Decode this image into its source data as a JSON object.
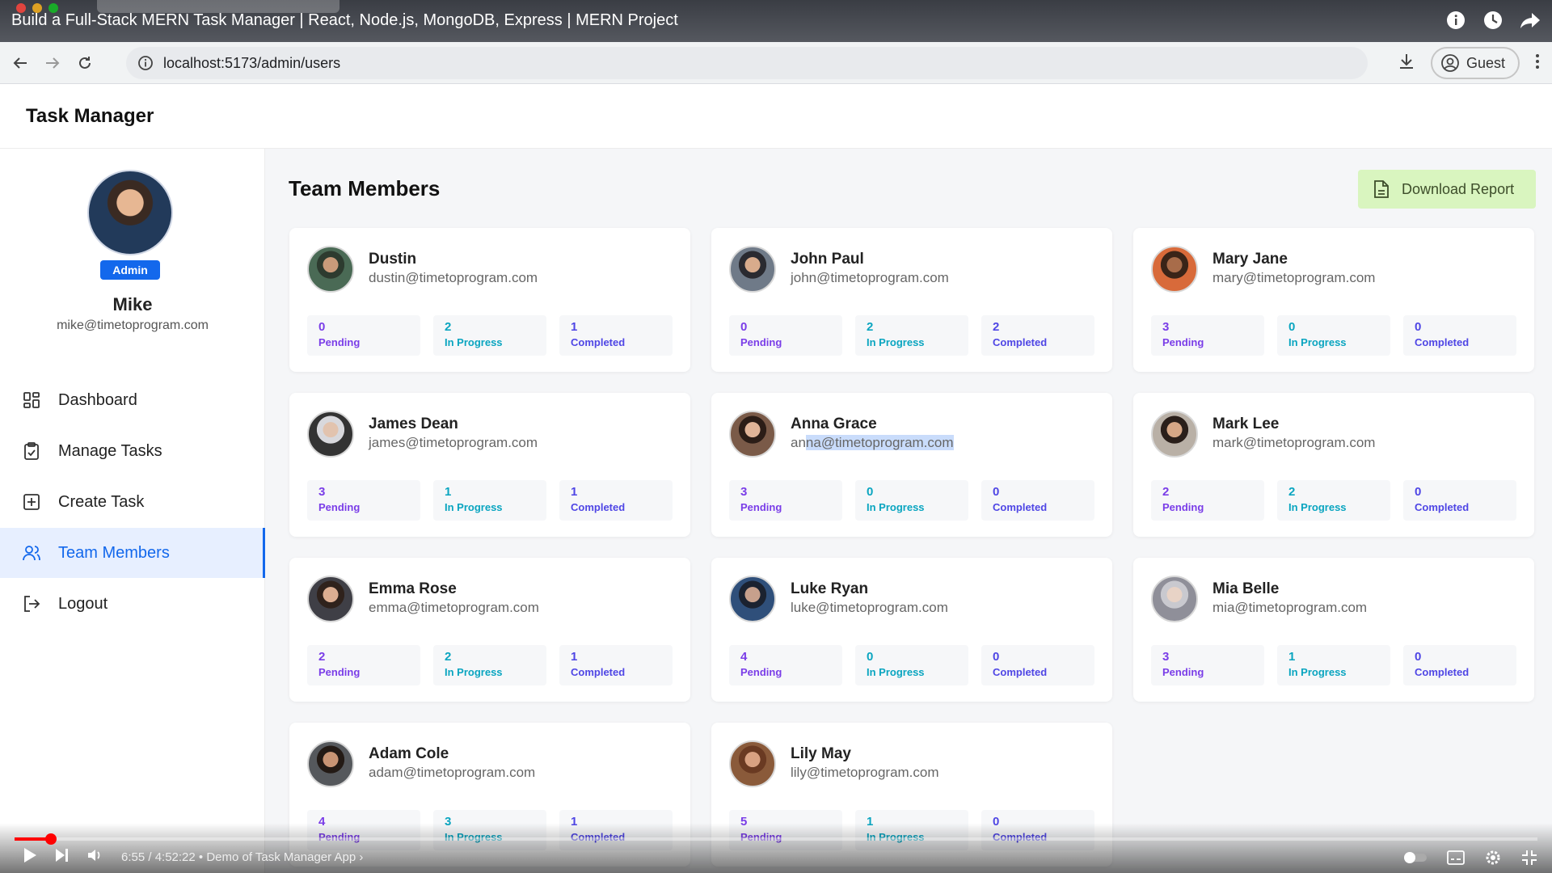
{
  "video": {
    "title": "Build a Full-Stack MERN Task Manager | React, Node.js, MongoDB, Express | MERN Project",
    "time": "6:55 / 4:52:22 • Demo of Task Manager App ›",
    "progress_fraction": 0.0237
  },
  "browser": {
    "url": "localhost:5173/admin/users",
    "profile_label": "Guest"
  },
  "app": {
    "title": "Task Manager"
  },
  "sidebar": {
    "role": "Admin",
    "name": "Mike",
    "email": "mike@timetoprogram.com",
    "items": [
      {
        "label": "Dashboard",
        "icon": "dashboard-icon",
        "active": false
      },
      {
        "label": "Manage Tasks",
        "icon": "clipboard-icon",
        "active": false
      },
      {
        "label": "Create Task",
        "icon": "plus-square-icon",
        "active": false
      },
      {
        "label": "Team Members",
        "icon": "users-icon",
        "active": true
      },
      {
        "label": "Logout",
        "icon": "logout-icon",
        "active": false
      }
    ]
  },
  "main": {
    "title": "Team Members",
    "download_label": "Download Report",
    "stat_labels": {
      "pending": "Pending",
      "in_progress": "In Progress",
      "completed": "Completed"
    },
    "members": [
      {
        "name": "Dustin",
        "email": "dustin@timetoprogram.com",
        "pending": 0,
        "in_progress": 2,
        "completed": 1
      },
      {
        "name": "John Paul",
        "email": "john@timetoprogram.com",
        "pending": 0,
        "in_progress": 2,
        "completed": 2
      },
      {
        "name": "Mary Jane",
        "email": "mary@timetoprogram.com",
        "pending": 3,
        "in_progress": 0,
        "completed": 0
      },
      {
        "name": "James Dean",
        "email": "james@timetoprogram.com",
        "pending": 3,
        "in_progress": 1,
        "completed": 1
      },
      {
        "name": "Anna Grace",
        "email": "anna@timetoprogram.com",
        "pending": 3,
        "in_progress": 0,
        "completed": 0
      },
      {
        "name": "Mark Lee",
        "email": "mark@timetoprogram.com",
        "pending": 2,
        "in_progress": 2,
        "completed": 0
      },
      {
        "name": "Emma Rose",
        "email": "emma@timetoprogram.com",
        "pending": 2,
        "in_progress": 2,
        "completed": 1
      },
      {
        "name": "Luke Ryan",
        "email": "luke@timetoprogram.com",
        "pending": 4,
        "in_progress": 0,
        "completed": 0
      },
      {
        "name": "Mia Belle",
        "email": "mia@timetoprogram.com",
        "pending": 3,
        "in_progress": 1,
        "completed": 0
      },
      {
        "name": "Adam Cole",
        "email": "adam@timetoprogram.com",
        "pending": 4,
        "in_progress": 3,
        "completed": 1
      },
      {
        "name": "Lily May",
        "email": "lily@timetoprogram.com",
        "pending": 5,
        "in_progress": 1,
        "completed": 0
      }
    ]
  },
  "colors": {
    "accent": "#1368ec",
    "pending": "#7a3de8",
    "in_progress": "#0aa5c0",
    "completed": "#4f46e5",
    "download_bg": "#d9f5bf"
  }
}
